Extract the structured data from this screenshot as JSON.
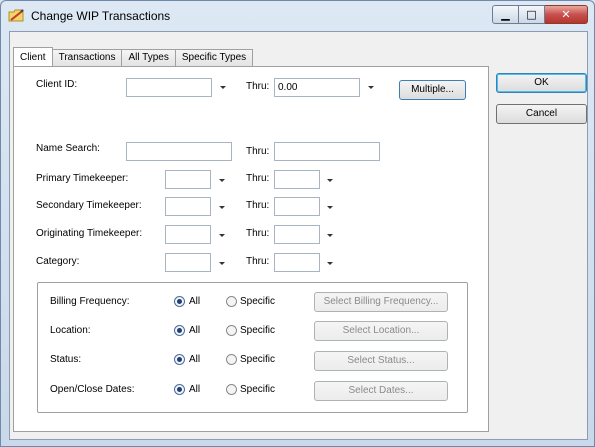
{
  "window": {
    "title": "Change WIP Transactions",
    "controls": {
      "minimize": "▁",
      "maximize": "□",
      "close": "✕"
    }
  },
  "tabs": [
    {
      "label": "Client",
      "active": true
    },
    {
      "label": "Transactions",
      "active": false
    },
    {
      "label": "All Types",
      "active": false
    },
    {
      "label": "Specific Types",
      "active": false
    }
  ],
  "dialog_buttons": {
    "ok": "OK",
    "cancel": "Cancel"
  },
  "client_id": {
    "label": "Client ID:",
    "from_value": "",
    "thru_label": "Thru:",
    "thru_value": "0.00",
    "multiple_label": "Multiple..."
  },
  "name_search": {
    "label": "Name Search:",
    "from_value": "",
    "thru_label": "Thru:",
    "thru_value": ""
  },
  "primary_timekeeper": {
    "label": "Primary Timekeeper:",
    "thru_label": "Thru:"
  },
  "secondary_timekeeper": {
    "label": "Secondary Timekeeper:",
    "thru_label": "Thru:"
  },
  "originating_timekeeper": {
    "label": "Originating Timekeeper:",
    "thru_label": "Thru:"
  },
  "category": {
    "label": "Category:",
    "thru_label": "Thru:"
  },
  "filters": [
    {
      "label": "Billing Frequency:",
      "all": "All",
      "specific": "Specific",
      "button": "Select Billing Frequency...",
      "selected": "All"
    },
    {
      "label": "Location:",
      "all": "All",
      "specific": "Specific",
      "button": "Select Location...",
      "selected": "All"
    },
    {
      "label": "Status:",
      "all": "All",
      "specific": "Specific",
      "button": "Select Status...",
      "selected": "All"
    },
    {
      "label": "Open/Close Dates:",
      "all": "All",
      "specific": "Specific",
      "button": "Select Dates...",
      "selected": "All"
    }
  ],
  "colors": {
    "accent": "#3c7fb1",
    "close_button": "#c75050",
    "radio_selected": "#1e3f79"
  }
}
